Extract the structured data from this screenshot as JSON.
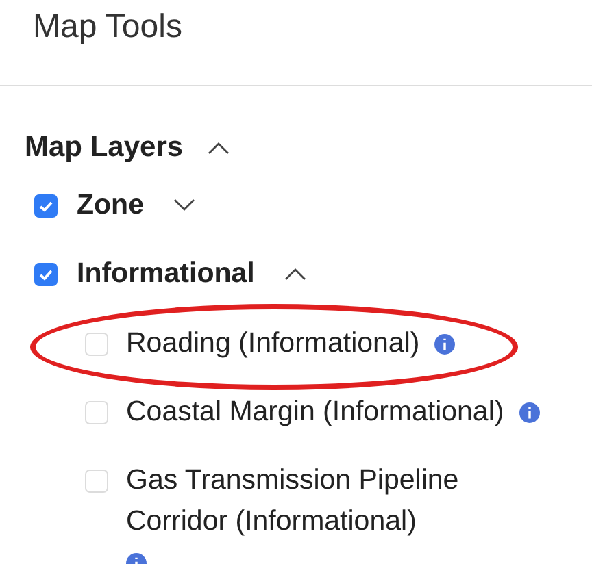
{
  "panel": {
    "title": "Map Tools"
  },
  "section": {
    "title": "Map Layers",
    "expanded": true,
    "groups": [
      {
        "label": "Zone",
        "checked": true,
        "expanded": false
      },
      {
        "label": "Informational",
        "checked": true,
        "expanded": true,
        "children": [
          {
            "label": "Roading (Informational)",
            "checked": false,
            "info": true,
            "circled": true
          },
          {
            "label": "Coastal Margin (Informational)",
            "checked": false,
            "info": true,
            "circled": false
          },
          {
            "label": "Gas Transmission Pipeline Corridor (Informational)",
            "checked": false,
            "info": true,
            "circled": false
          }
        ]
      }
    ]
  }
}
